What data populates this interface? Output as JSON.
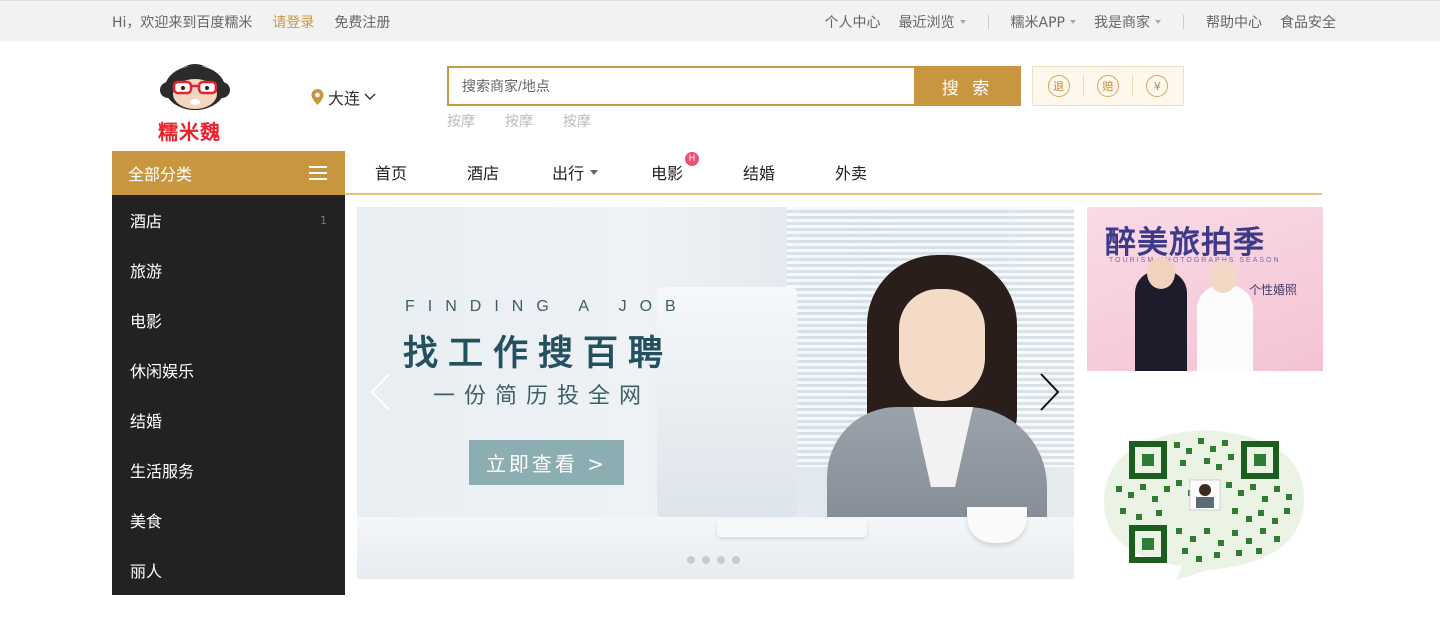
{
  "topbar": {
    "greeting": "Hi，欢迎来到百度糯米",
    "login": "请登录",
    "register": "免费注册",
    "personal_center": "个人中心",
    "recent": "最近浏览",
    "app": "糯米APP",
    "merchant": "我是商家",
    "help": "帮助中心",
    "food_safety": "食品安全"
  },
  "header": {
    "logo_text": "糯米魏",
    "city": "大连",
    "search_placeholder": "搜索商家/地点",
    "search_button": "搜 索",
    "hot_words": [
      "按摩",
      "按摩",
      "按摩"
    ],
    "badges": [
      "退",
      "赔",
      "¥"
    ]
  },
  "category": {
    "title": "全部分类",
    "items": [
      {
        "label": "酒店",
        "count": "1"
      },
      {
        "label": "旅游",
        "count": ""
      },
      {
        "label": "电影",
        "count": ""
      },
      {
        "label": "休闲娱乐",
        "count": ""
      },
      {
        "label": "结婚",
        "count": ""
      },
      {
        "label": "生活服务",
        "count": ""
      },
      {
        "label": "美食",
        "count": ""
      },
      {
        "label": "丽人",
        "count": ""
      }
    ]
  },
  "nav": {
    "items": [
      "首页",
      "酒店",
      "出行",
      "电影",
      "结婚",
      "外卖"
    ],
    "hot_badge": "H"
  },
  "banner": {
    "english": "FINDING A JOB",
    "title": "找工作搜百聘",
    "subtitle": "一份简历投全网",
    "button": "立即查看 >",
    "slide_count": 4
  },
  "ad": {
    "title": "醉美旅拍季",
    "subtitle": "TOURISM    PHOTOGRAPHS SEASON",
    "tag": "个性婚照"
  },
  "colors": {
    "accent": "#c8963e",
    "sidebar_bg": "#222222",
    "login_link": "#c59a4b"
  }
}
